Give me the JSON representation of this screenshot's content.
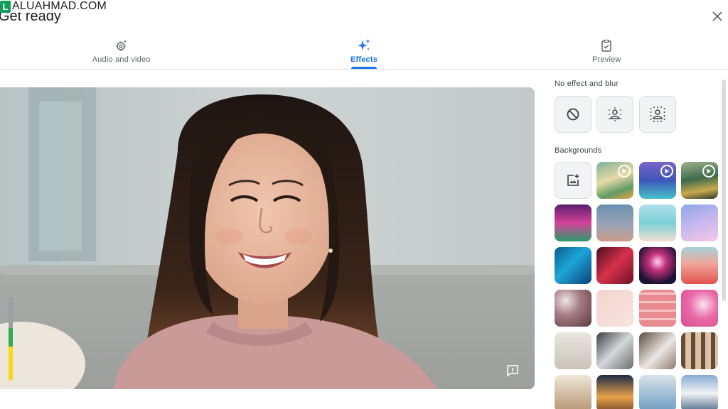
{
  "watermark": {
    "logo_letter": "L",
    "text": "ALUAHMAD.COM"
  },
  "dialog": {
    "title": "Get ready",
    "close_icon": "close-icon"
  },
  "tabs": [
    {
      "label": "Audio and video",
      "icon": "settings-sparkle-icon",
      "active": false
    },
    {
      "label": "Effects",
      "icon": "sparkle-icon",
      "active": true
    },
    {
      "label": "Preview",
      "icon": "clipboard-check-icon",
      "active": false
    }
  ],
  "video": {
    "audio_level": 0.5,
    "feedback_icon": "feedback-icon"
  },
  "effects_panel": {
    "no_effect_label": "No effect and blur",
    "no_effect_options": [
      "no-effect-icon",
      "slight-blur-icon",
      "blur-icon"
    ],
    "backgrounds_label": "Backgrounds",
    "upload_icon": "add-image-icon",
    "colors": {
      "accent": "#1a73e8",
      "tile_bg": "#f1f3f4",
      "meter_green": "#34a853",
      "meter_yellow": "#f9d71c"
    }
  }
}
